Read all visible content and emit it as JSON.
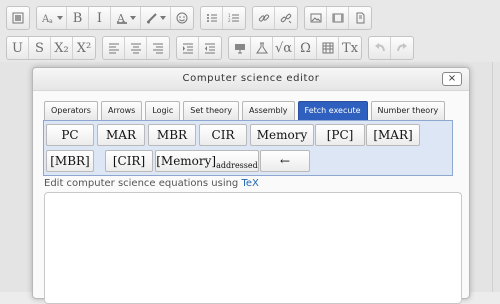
{
  "toolbar": {
    "row1": [
      [
        {
          "icon": "show-blocks-icon"
        }
      ],
      [
        {
          "icon": "font-color-icon",
          "dropdown": true
        },
        {
          "text": "B",
          "name": "bold-button"
        },
        {
          "text": "I",
          "name": "italic-button"
        },
        {
          "icon": "text-color-icon",
          "dropdown": true
        },
        {
          "icon": "paint-brush-icon",
          "dropdown": true
        },
        {
          "icon": "smiley-icon"
        }
      ],
      [
        {
          "icon": "bullet-list-icon"
        },
        {
          "icon": "numbered-list-icon"
        }
      ],
      [
        {
          "icon": "link-icon"
        },
        {
          "icon": "unlink-icon"
        }
      ],
      [
        {
          "icon": "image-icon"
        },
        {
          "icon": "media-icon"
        },
        {
          "icon": "file-icon"
        }
      ]
    ],
    "row2": [
      [
        {
          "text": "U",
          "name": "underline-button"
        },
        {
          "text": "S",
          "name": "strikethrough-button"
        },
        {
          "text": "X₂",
          "name": "subscript-button"
        },
        {
          "text": "X²",
          "name": "superscript-button"
        }
      ],
      [
        {
          "icon": "align-left-icon"
        },
        {
          "icon": "align-center-icon"
        },
        {
          "icon": "align-right-icon"
        }
      ],
      [
        {
          "icon": "indent-icon"
        },
        {
          "icon": "outdent-icon"
        }
      ],
      [
        {
          "icon": "screen-icon"
        },
        {
          "icon": "flask-icon"
        },
        {
          "text": "√α",
          "name": "equation-button"
        },
        {
          "text": "Ω",
          "name": "special-char-button"
        },
        {
          "icon": "table-icon"
        },
        {
          "text": "Tx",
          "name": "clear-format-button"
        }
      ],
      [
        {
          "icon": "undo-icon",
          "disabled": true
        },
        {
          "icon": "redo-icon",
          "disabled": true
        }
      ]
    ]
  },
  "dialog": {
    "title": "Computer science editor",
    "close_label": "×",
    "tabs": [
      {
        "label": "Operators"
      },
      {
        "label": "Arrows"
      },
      {
        "label": "Logic"
      },
      {
        "label": "Set theory"
      },
      {
        "label": "Assembly"
      },
      {
        "label": "Fetch execute",
        "active": true
      },
      {
        "label": "Number theory"
      }
    ],
    "palette": [
      {
        "label": "PC"
      },
      {
        "label": "MAR"
      },
      {
        "label": "MBR"
      },
      {
        "label": "CIR"
      },
      {
        "label": "Memory"
      },
      {
        "label": "[PC]"
      },
      {
        "label": "[MAR]"
      },
      {
        "label": "[MBR]"
      },
      {
        "label": "[CIR]"
      },
      {
        "label": "[Memory]",
        "sub": "addressed"
      },
      {
        "label": "←"
      }
    ],
    "helper_text": "Edit computer science equations using ",
    "helper_link": "TeX"
  }
}
